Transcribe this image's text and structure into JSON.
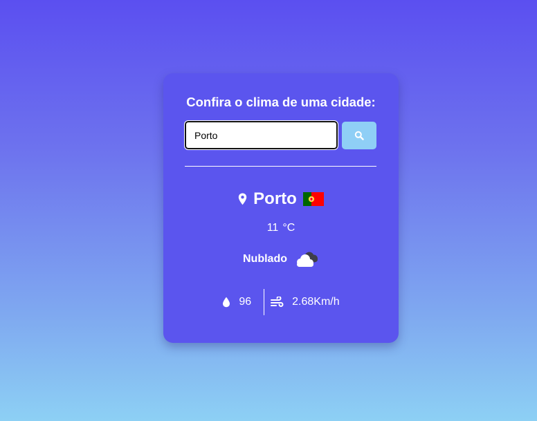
{
  "heading": "Confira o clima de uma cidade:",
  "search": {
    "value": "Porto",
    "icon": "search-icon"
  },
  "weather": {
    "city": "Porto",
    "country_flag": "portugal-flag",
    "temperature": "11",
    "unit": "°C",
    "description": "Nublado",
    "description_icon": "cloud-icon",
    "humidity": "96",
    "humidity_icon": "droplet-icon",
    "wind": "2.68Km/h",
    "wind_icon": "wind-icon"
  },
  "colors": {
    "card": "#5b55ee",
    "button": "#8fcff6",
    "gradient_top": "#5b4ff0",
    "gradient_bottom": "#8dd0f4"
  }
}
